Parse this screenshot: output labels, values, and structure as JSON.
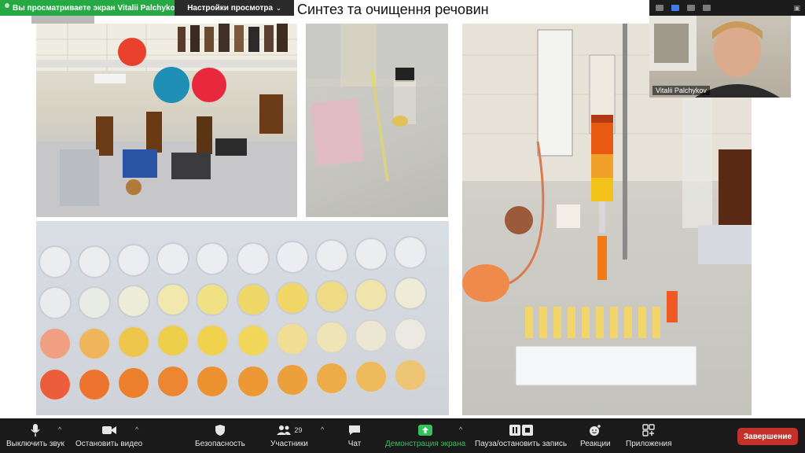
{
  "banner": {
    "viewing_text": "Вы просматриваете экран Vitalii Palchykov",
    "view_options": "Настройки просмотра"
  },
  "slide": {
    "title": "Синтез та очищення речовин"
  },
  "video": {
    "participant_name": "Vitalii Palchykov"
  },
  "toolbar": {
    "mute_label": "Выключить звук",
    "video_label": "Остановить видео",
    "security_label": "Безопасность",
    "participants_label": "Участники",
    "participants_count": "29",
    "chat_label": "Чат",
    "share_label": "Демонстрация экрана",
    "pause_label": "Пауза/остановить запись",
    "reactions_label": "Реакции",
    "apps_label": "Приложения",
    "end_label": "Завершение"
  },
  "colors": {
    "share_green": "#26a844",
    "end_red": "#c4312b",
    "share_icon_green": "#35c15b"
  }
}
